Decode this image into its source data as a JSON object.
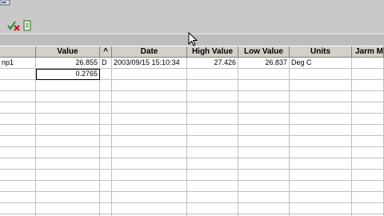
{
  "toolbar": {
    "icons": [
      "small-icon",
      "check-cancel-icon",
      "document-icon"
    ]
  },
  "grid": {
    "headers": {
      "name": "",
      "value": "Value",
      "flag": "^",
      "date": "Date",
      "high_value": "High Value",
      "low_value": "Low Value",
      "units": "Units",
      "alarm_message": "Jarm Me"
    },
    "rows": [
      {
        "name": "np1",
        "value": "26.855",
        "flag": "D",
        "date": "2003/09/15 15:10:34",
        "high_value": "27.426",
        "low_value": "26.837",
        "units": "Deg C",
        "alarm_message": ""
      },
      {
        "name": "",
        "value": "0.2765",
        "flag": "",
        "date": "",
        "high_value": "",
        "low_value": "",
        "units": "",
        "alarm_message": ""
      }
    ]
  },
  "colors": {
    "toolbar_bg": "#c9c9c9",
    "header_bg": "#d4d0c8",
    "grid_line": "#c0c0c0"
  }
}
